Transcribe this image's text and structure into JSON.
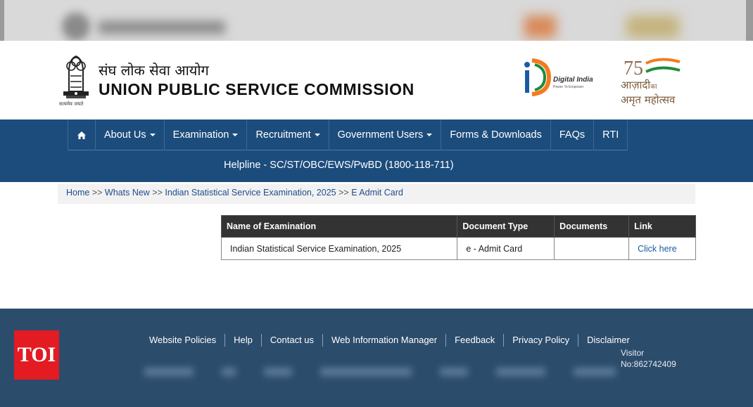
{
  "header": {
    "emblem_caption": "सत्यमेव जयते",
    "title_hindi": "संघ लोक सेवा आयोग",
    "title_english": "UNION PUBLIC SERVICE COMMISSION",
    "digital_india": {
      "brand": "Digital India",
      "tagline": "Power To Empower"
    },
    "azadi": {
      "number": "75",
      "text_line1": "आज़ादी",
      "small": "का",
      "text_line2": "अमृत महोत्सव"
    }
  },
  "nav": {
    "items": [
      {
        "label": "About Us",
        "dropdown": true
      },
      {
        "label": "Examination",
        "dropdown": true
      },
      {
        "label": "Recruitment",
        "dropdown": true
      },
      {
        "label": "Government Users",
        "dropdown": true
      },
      {
        "label": "Forms & Downloads",
        "dropdown": false
      },
      {
        "label": "FAQs",
        "dropdown": false
      },
      {
        "label": "RTI",
        "dropdown": false
      }
    ],
    "helpline": "Helpline - SC/ST/OBC/EWS/PwBD (1800-118-711)"
  },
  "breadcrumb": {
    "items": [
      "Home",
      "Whats New",
      "Indian Statistical Service Examination, 2025"
    ],
    "current": "E Admit Card",
    "separator": ">>"
  },
  "table": {
    "headers": [
      "Name of Examination",
      "Document Type",
      "Documents",
      "Link"
    ],
    "rows": [
      [
        "Indian Statistical Service Examination, 2025",
        "e - Admit Card",
        "",
        "Click here"
      ]
    ]
  },
  "footer": {
    "links": [
      "Website Policies",
      "Help",
      "Contact us",
      "Web Information Manager",
      "Feedback",
      "Privacy Policy",
      "Disclaimer"
    ],
    "visitor_label": "Visitor",
    "visitor_number": "No:862742409"
  },
  "watermark": "TOI",
  "colors": {
    "nav_bg": "#1c4c7c",
    "footer_bg": "#2c4c6c",
    "table_header_bg": "#333333",
    "link_color": "#1c5aa0",
    "toi_red": "#e31b23"
  }
}
